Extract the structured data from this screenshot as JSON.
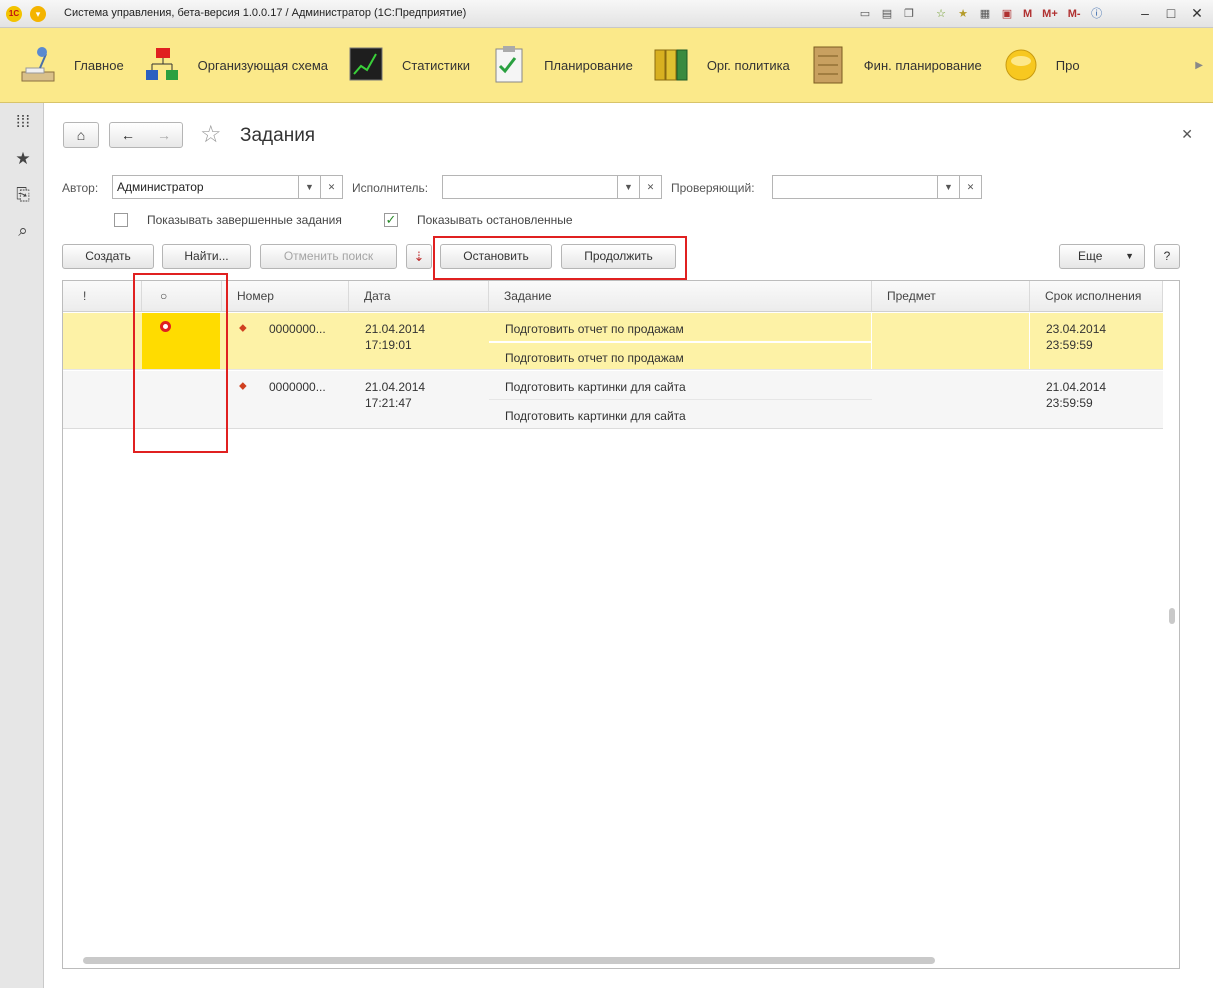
{
  "window": {
    "title": "Система управления, бета-версия 1.0.0.17 / Администратор  (1С:Предприятие)",
    "tools_mtext": [
      "M",
      "M+",
      "M-"
    ]
  },
  "sections": [
    {
      "label": "Главное",
      "icon": "desk-lamp-icon"
    },
    {
      "label": "Организующая схема",
      "icon": "org-chart-icon"
    },
    {
      "label": "Статистики",
      "icon": "chart-board-icon"
    },
    {
      "label": "Планирование",
      "icon": "clipboard-check-icon"
    },
    {
      "label": "Орг. политика",
      "icon": "binders-icon"
    },
    {
      "label": "Фин. планирование",
      "icon": "abacus-icon"
    },
    {
      "label": "Про",
      "icon": "disc-icon"
    }
  ],
  "form": {
    "title": "Задания",
    "filters": {
      "author_label": "Автор:",
      "author_value": "Администратор",
      "executor_label": "Исполнитель:",
      "executor_value": "",
      "reviewer_label": "Проверяющий:",
      "reviewer_value": ""
    },
    "checkboxes": {
      "show_completed": {
        "label": "Показывать завершенные задания",
        "checked": false
      },
      "show_stopped": {
        "label": "Показывать остановленные",
        "checked": true
      }
    },
    "commands": {
      "create": "Создать",
      "find": "Найти...",
      "cancel_search": "Отменить поиск",
      "stop": "Остановить",
      "continue": "Продолжить",
      "more": "Еще",
      "help": "?"
    },
    "table": {
      "columns": [
        "!",
        "○",
        "Номер",
        "Дата",
        "Задание",
        "Предмет",
        "Срок исполнения"
      ],
      "rows": [
        {
          "number": "0000000...",
          "date": "21.04.2014",
          "time": "17:19:01",
          "task": "Подготовить отчет по продажам",
          "task_desc": "Подготовить отчет по продажам",
          "subject": "",
          "due_date": "23.04.2014",
          "due_time": "23:59:59",
          "stopped": true,
          "selected": true
        },
        {
          "number": "0000000...",
          "date": "21.04.2014",
          "time": "17:21:47",
          "task": "Подготовить картинки для сайта",
          "task_desc": "Подготовить картинки для сайта",
          "subject": "",
          "due_date": "21.04.2014",
          "due_time": "23:59:59",
          "stopped": false,
          "selected": false
        }
      ]
    }
  },
  "colors": {
    "section_bar": "#fbe98a",
    "selected_row": "#fdf2a6",
    "stopped_cell": "#ffdc00",
    "highlight_frame": "#e02020"
  }
}
